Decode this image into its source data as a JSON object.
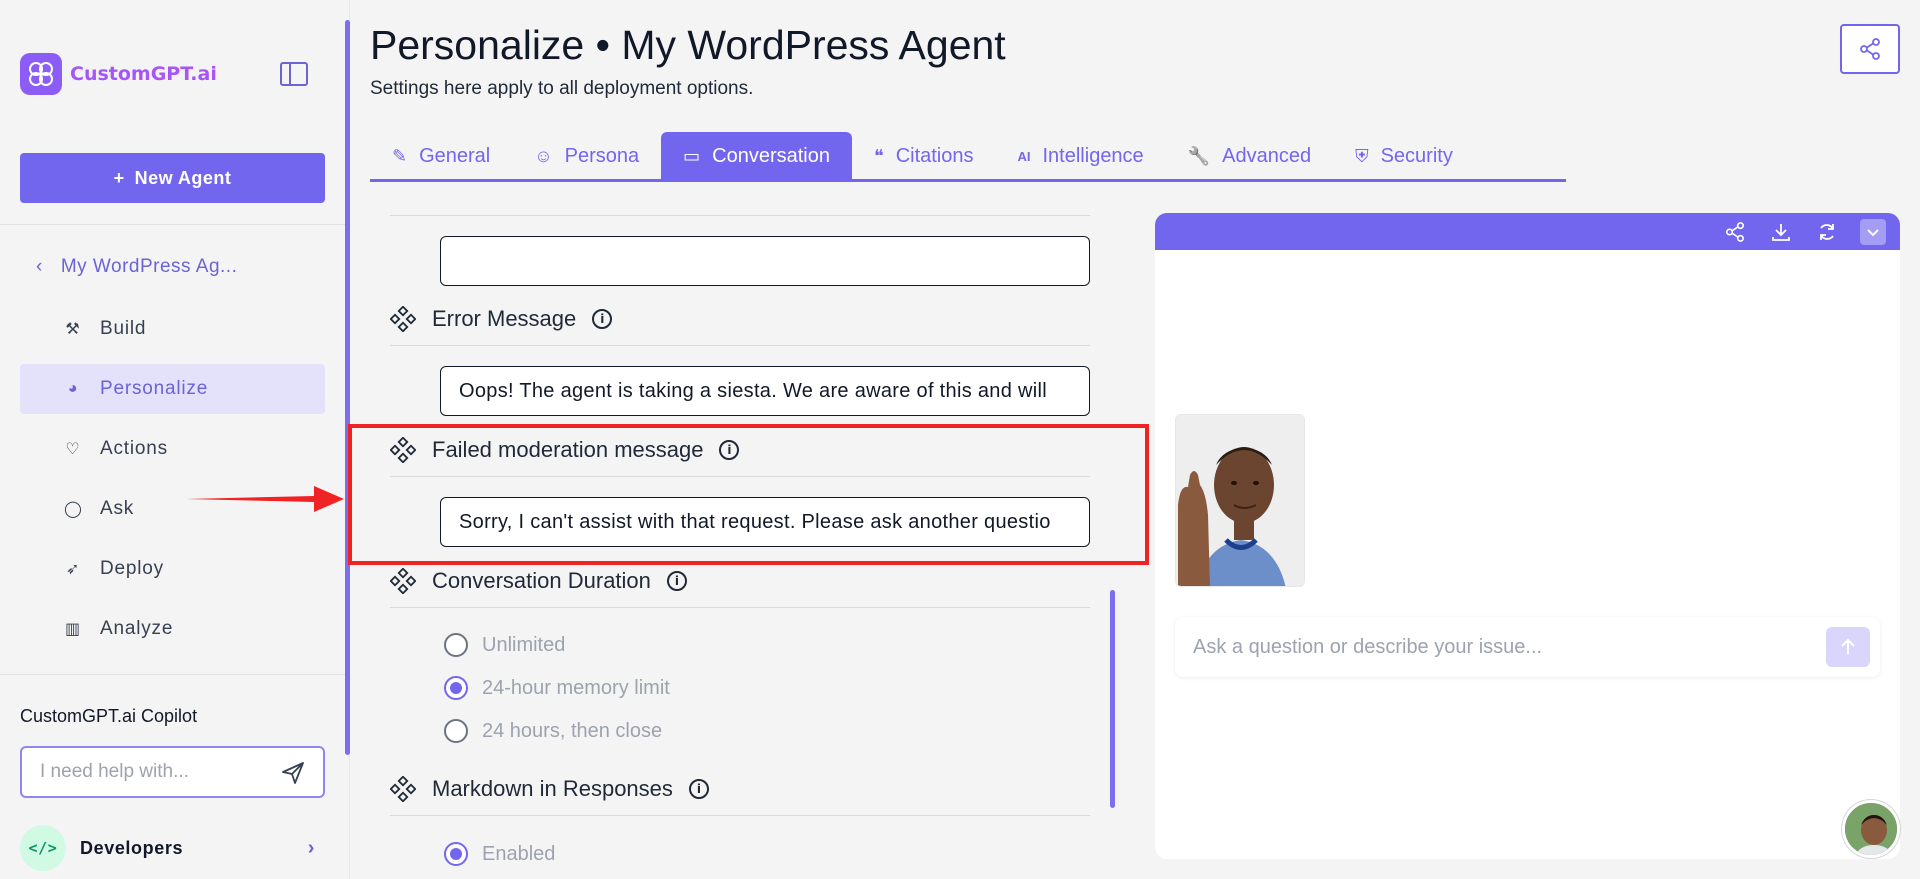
{
  "brand": {
    "name": "CustomGPT.ai",
    "mark": "GPT"
  },
  "sidebar": {
    "new_agent_label": "New Agent",
    "agent_name": "My WordPress Ag...",
    "items": [
      {
        "label": "Build",
        "icon": "build-icon"
      },
      {
        "label": "Personalize",
        "icon": "palette-icon"
      },
      {
        "label": "Actions",
        "icon": "actions-icon"
      },
      {
        "label": "Ask",
        "icon": "chat-icon"
      },
      {
        "label": "Deploy",
        "icon": "rocket-icon"
      },
      {
        "label": "Analyze",
        "icon": "chart-icon"
      }
    ],
    "copilot_title": "CustomGPT.ai Copilot",
    "copilot_placeholder": "I need help with...",
    "developers_label": "Developers"
  },
  "header": {
    "title": "Personalize • My WordPress Agent",
    "subtitle": "Settings here apply to all deployment options."
  },
  "tabs": [
    {
      "label": "General",
      "icon": "✎"
    },
    {
      "label": "Persona",
      "icon": "☺"
    },
    {
      "label": "Conversation",
      "icon": "▭"
    },
    {
      "label": "Citations",
      "icon": "❝"
    },
    {
      "label": "Intelligence",
      "icon": "AI"
    },
    {
      "label": "Advanced",
      "icon": "🔧"
    },
    {
      "label": "Security",
      "icon": "⛨"
    }
  ],
  "form": {
    "top_input_value": "",
    "error_message": {
      "label": "Error Message",
      "value": "Oops! The agent is taking a siesta. We are aware of this and will"
    },
    "failed_moderation": {
      "label": "Failed moderation message",
      "value": "Sorry, I can't assist with that request. Please ask another questio"
    },
    "conversation_duration": {
      "label": "Conversation Duration",
      "options": [
        "Unlimited",
        "24-hour memory limit",
        "24 hours, then close"
      ],
      "selected": "24-hour memory limit"
    },
    "markdown": {
      "label": "Markdown in Responses",
      "option": "Enabled"
    }
  },
  "preview": {
    "chat_placeholder": "Ask a question or describe your issue..."
  },
  "colors": {
    "accent": "#7366ee",
    "highlight": "#ef2323"
  }
}
